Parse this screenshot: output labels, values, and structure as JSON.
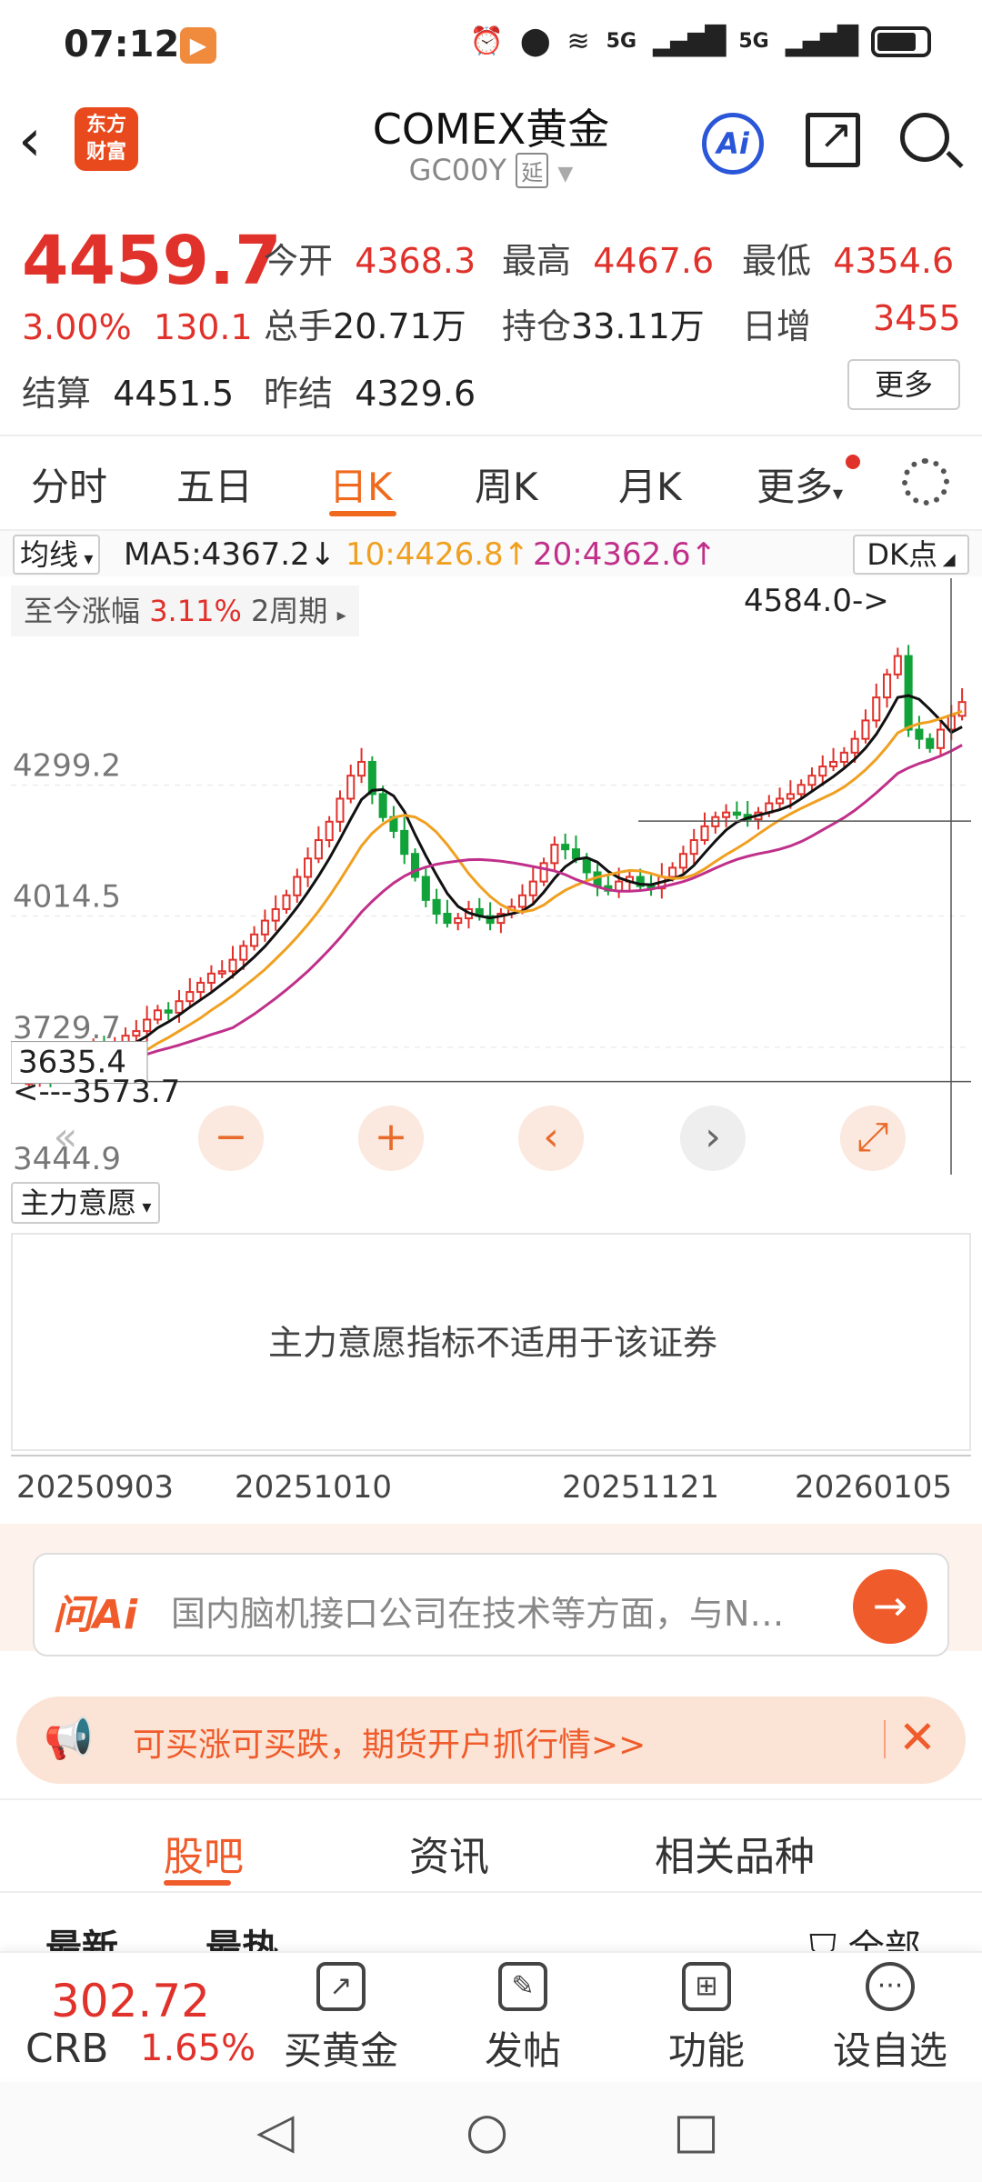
{
  "status": {
    "time": "07:12",
    "app_badge": "▶",
    "icons": [
      "alarm-icon",
      "location-icon",
      "wifi-icon",
      "5g-signal-icon",
      "5g-signal-icon",
      "battery-icon"
    ],
    "net1": "5G",
    "net2": "5G"
  },
  "header": {
    "logo_line1": "东方",
    "logo_line2": "财富",
    "title": "COMEX黄金",
    "code": "GC00Y",
    "tag": "延",
    "ai_label": "Ai"
  },
  "quote": {
    "price": "4459.7",
    "change_pct": "3.00%",
    "change": "130.1",
    "open_label": "今开",
    "open": "4368.3",
    "high_label": "最高",
    "high": "4467.6",
    "low_label": "最低",
    "low": "4354.6",
    "vol_label": "总手",
    "vol": "20.71万",
    "oi_label": "持仓",
    "oi": "33.11万",
    "inc_label": "日增",
    "inc": "3455",
    "settle_label": "结算",
    "settle": "4451.5",
    "prev_label": "昨结",
    "prev": "4329.6",
    "more": "更多"
  },
  "tabs": [
    "分时",
    "五日",
    "日K",
    "周K",
    "月K",
    "更多"
  ],
  "ma": {
    "selector": "均线",
    "ma5": "MA5:4367.2↓",
    "ma10": "10:4426.8↑",
    "ma20": "20:4362.6↑",
    "dk": "DK点"
  },
  "chart": {
    "range_label": "至今涨幅",
    "range_value": "3.11%",
    "range_period": "2周期",
    "yticks": [
      "4299.2",
      "4014.5",
      "3729.7",
      "3444.9"
    ],
    "max_label": "4584.0->",
    "min_label": "<---3573.7",
    "crosshair_value": "3635.4",
    "colors": {
      "up": "#e0312b",
      "down": "#12a23a",
      "ma5": "#111111",
      "ma10": "#f0a020",
      "ma20": "#c0308a"
    }
  },
  "chart_data": {
    "type": "candlestick",
    "ylim": [
      3444.9,
      4650
    ],
    "x_labels": [
      "20250903",
      "20251010",
      "20251121",
      "20260105"
    ],
    "close": [
      3640,
      3655,
      3645,
      3662,
      3670,
      3690,
      3705,
      3700,
      3720,
      3735,
      3745,
      3770,
      3790,
      3785,
      3810,
      3830,
      3850,
      3870,
      3875,
      3900,
      3930,
      3955,
      3985,
      4010,
      4040,
      4080,
      4120,
      4160,
      4200,
      4250,
      4300,
      4330,
      4260,
      4210,
      4180,
      4130,
      4080,
      4030,
      4000,
      3980,
      3990,
      4010,
      3995,
      3980,
      4000,
      4015,
      4040,
      4070,
      4110,
      4150,
      4140,
      4120,
      4090,
      4060,
      4050,
      4070,
      4080,
      4060,
      4055,
      4080,
      4100,
      4130,
      4160,
      4190,
      4210,
      4220,
      4215,
      4205,
      4220,
      4240,
      4250,
      4260,
      4280,
      4300,
      4320,
      4330,
      4350,
      4380,
      4420,
      4470,
      4520,
      4560,
      4400,
      4380,
      4360,
      4400,
      4430,
      4460
    ],
    "ma5": "computed",
    "series_names": [
      "MA5",
      "MA10",
      "MA20"
    ]
  },
  "indicator": {
    "selector": "主力意愿",
    "message": "主力意愿指标不适用于该证券"
  },
  "controls": [
    "«",
    "−",
    "+",
    "‹",
    "›",
    "⤢"
  ],
  "ask": {
    "brand": "问Ai",
    "placeholder": "国内脑机接口公司在技术等方面，与N…",
    "go": "→"
  },
  "promo": {
    "text": "可买涨可买跌，期货开户抓行情>>",
    "close": "✕"
  },
  "bottom_tabs": [
    "股吧",
    "资讯",
    "相关品种"
  ],
  "sort": {
    "latest": "最新",
    "hot": "最热",
    "all": "全部"
  },
  "bottombar": {
    "crb_value": "302.72",
    "crb_name": "CRB",
    "crb_pct": "1.65%",
    "items": [
      "买黄金",
      "发帖",
      "功能",
      "设自选"
    ]
  },
  "sysnav": {
    "back": "◁",
    "home": "○",
    "recent": "□"
  }
}
